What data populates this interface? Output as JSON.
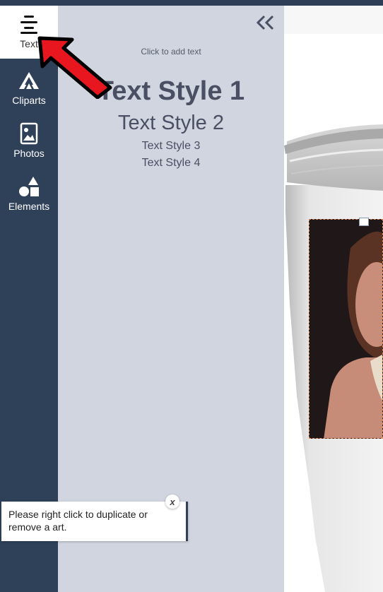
{
  "sidebar": {
    "items": [
      {
        "label": "Text",
        "icon": "text-align-icon",
        "active": true
      },
      {
        "label": "Cliparts",
        "icon": "cliparts-icon"
      },
      {
        "label": "Photos",
        "icon": "photo-icon"
      },
      {
        "label": "Elements",
        "icon": "shapes-icon"
      }
    ]
  },
  "panel": {
    "hint": "Click to add text",
    "text_styles": [
      "Text Style 1",
      "Text Style 2",
      "Text Style 3",
      "Text Style 4"
    ],
    "collapse_icon": "double-chevron-left-icon"
  },
  "tooltip": {
    "message": "Please right click to duplicate or remove a art.",
    "close_label": "x"
  },
  "colors": {
    "sidebar_bg": "#2f4159",
    "panel_bg": "#d1d5e0",
    "text_style_color": "#4a4f63",
    "arrow_red": "#e8161f"
  }
}
